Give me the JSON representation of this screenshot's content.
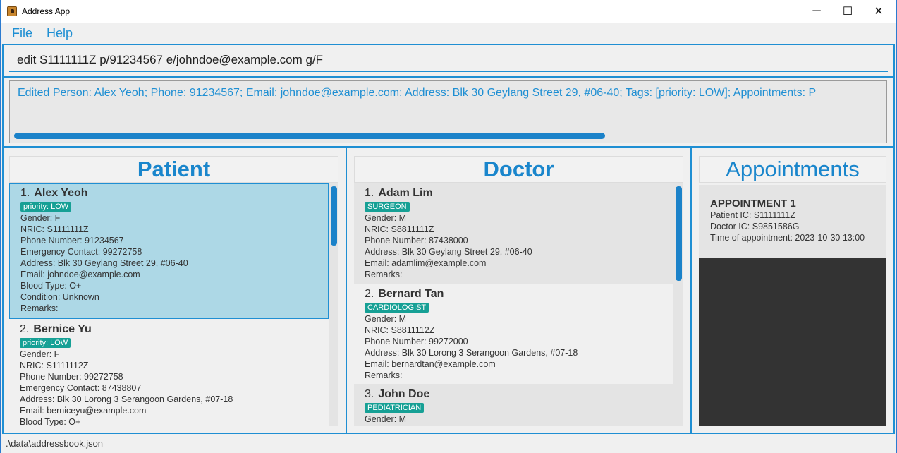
{
  "window": {
    "title": "Address App",
    "minimize": "─",
    "maximize": "☐",
    "close": "✕"
  },
  "menu": {
    "file": "File",
    "help": "Help"
  },
  "command": {
    "value": "edit S1111111Z p/91234567 e/johndoe@example.com g/F"
  },
  "result": {
    "text": "Edited Person: Alex Yeoh; Phone: 91234567; Email: johndoe@example.com; Address: Blk 30 Geylang Street 29, #06-40; Tags: [priority: LOW]; Appointments: P"
  },
  "headers": {
    "patient": "Patient",
    "doctor": "Doctor",
    "appointments": "Appointments"
  },
  "patients": [
    {
      "index": "1.",
      "name": "Alex Yeoh",
      "tag": "priority: LOW",
      "gender": "Gender: F",
      "nric": "NRIC: S1111111Z",
      "phone": "Phone Number: 91234567",
      "emergency": "Emergency Contact: 99272758",
      "address": "Address: Blk 30 Geylang Street 29, #06-40",
      "email": "Email: johndoe@example.com",
      "blood": "Blood Type: O+",
      "condition": "Condition: Unknown",
      "remarks": "Remarks:"
    },
    {
      "index": "2.",
      "name": "Bernice Yu",
      "tag": "priority: LOW",
      "gender": "Gender: F",
      "nric": "NRIC: S1111112Z",
      "phone": "Phone Number: 99272758",
      "emergency": "Emergency Contact: 87438807",
      "address": "Address: Blk 30 Lorong 3 Serangoon Gardens, #07-18",
      "email": "Email: berniceyu@example.com",
      "blood": "Blood Type: O+"
    }
  ],
  "doctors": [
    {
      "index": "1.",
      "name": "Adam Lim",
      "tag": "SURGEON",
      "gender": "Gender: M",
      "nric": "NRIC: S8811111Z",
      "phone": "Phone Number: 87438000",
      "address": "Address: Blk 30 Geylang Street 29, #06-40",
      "email": "Email: adamlim@example.com",
      "remarks": "Remarks:"
    },
    {
      "index": "2.",
      "name": "Bernard Tan",
      "tag": "CARDIOLOGIST",
      "gender": "Gender: M",
      "nric": "NRIC: S8811112Z",
      "phone": "Phone Number: 99272000",
      "address": "Address: Blk 30 Lorong 3 Serangoon Gardens, #07-18",
      "email": "Email: bernardtan@example.com",
      "remarks": "Remarks:"
    },
    {
      "index": "3.",
      "name": "John Doe",
      "tag": "PEDIATRICIAN",
      "gender": "Gender: M"
    }
  ],
  "appointments": [
    {
      "title": "APPOINTMENT 1",
      "patient": "Patient IC: S1111111Z",
      "doctor": "Doctor IC: S9851586G",
      "time": "Time of appointment: 2023-10-30 13:00"
    }
  ],
  "status": {
    "path": ".\\data\\addressbook.json"
  },
  "colors": {
    "accent": "#1f8fd3",
    "selected": "#add8e6",
    "tag": "#16a095",
    "dark_panel": "#333333"
  }
}
